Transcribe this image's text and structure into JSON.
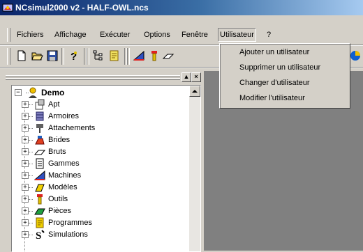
{
  "window": {
    "title": "NCsimul2000 v2 - HALF-OWL.ncs"
  },
  "menubar": [
    {
      "label": "Fichiers",
      "active": false
    },
    {
      "label": "Affichage",
      "active": false
    },
    {
      "label": "Exécuter",
      "active": false
    },
    {
      "label": "Options",
      "active": false
    },
    {
      "label": "Fenêtre",
      "active": false
    },
    {
      "label": "Utilisateur",
      "active": true
    },
    {
      "label": "?",
      "active": false
    }
  ],
  "dropdown": {
    "items": [
      "Ajouter un utilisateur",
      "Supprimer un utilisateur",
      "Changer d'utilisateur",
      "Modifier l'utilisateur"
    ]
  },
  "toolbar": {
    "icons": [
      "new-file-icon",
      "open-folder-icon",
      "save-icon",
      "help-icon",
      "tree-structure-icon",
      "notepad-icon",
      "machine-icon",
      "tool-icon",
      "eraser-icon",
      "sphere-icon"
    ]
  },
  "tree": {
    "root": "Demo",
    "children": [
      {
        "label": "Apt",
        "icon": "apt-icon"
      },
      {
        "label": "Armoires",
        "icon": "cabinet-icon"
      },
      {
        "label": "Attachements",
        "icon": "attachment-icon"
      },
      {
        "label": "Brides",
        "icon": "clamp-icon"
      },
      {
        "label": "Bruts",
        "icon": "stock-icon"
      },
      {
        "label": "Gammes",
        "icon": "list-icon"
      },
      {
        "label": "Machines",
        "icon": "machine-icon"
      },
      {
        "label": "Modèles",
        "icon": "model-icon"
      },
      {
        "label": "Outils",
        "icon": "tool-icon"
      },
      {
        "label": "Pièces",
        "icon": "part-icon"
      },
      {
        "label": "Programmes",
        "icon": "program-icon"
      },
      {
        "label": "Simulations",
        "icon": "simulation-icon"
      }
    ]
  },
  "colors": {
    "title_bar": "#0a246a",
    "face": "#d4d0c8",
    "mdi": "#808080"
  }
}
